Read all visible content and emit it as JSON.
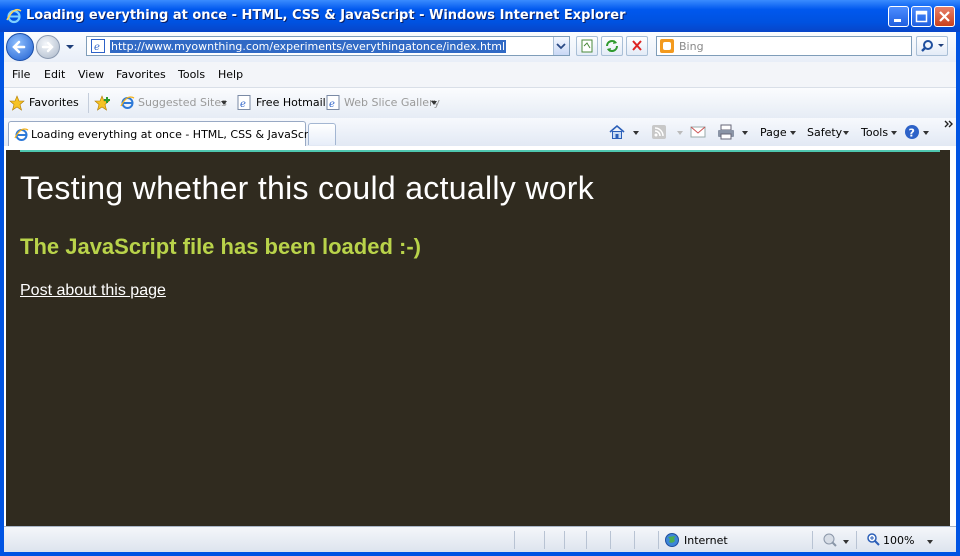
{
  "window": {
    "title": "Loading everything at once - HTML, CSS & JavaScript - Windows Internet Explorer"
  },
  "address_bar": {
    "url": "http://www.myownthing.com/experiments/everythingatonce/index.html",
    "search_placeholder": "Bing"
  },
  "menu": {
    "items": [
      "File",
      "Edit",
      "View",
      "Favorites",
      "Tools",
      "Help"
    ]
  },
  "favorites_bar": {
    "favorites_label": "Favorites",
    "items": [
      "Suggested Sites",
      "Free Hotmail",
      "Web Slice Gallery"
    ]
  },
  "tab": {
    "label": "Loading everything at once - HTML, CSS & JavaScript"
  },
  "command_bar": {
    "page": "Page",
    "safety": "Safety",
    "tools": "Tools"
  },
  "page": {
    "heading": "Testing whether this could actually work",
    "subheading": "The JavaScript file has been loaded :-)",
    "link": "Post about this page"
  },
  "status_bar": {
    "zone": "Internet",
    "zoom": "100%"
  },
  "colors": {
    "page_background": "#302b1f",
    "subheading": "#b9d34a",
    "accent_rule": "#4fc7b0"
  }
}
